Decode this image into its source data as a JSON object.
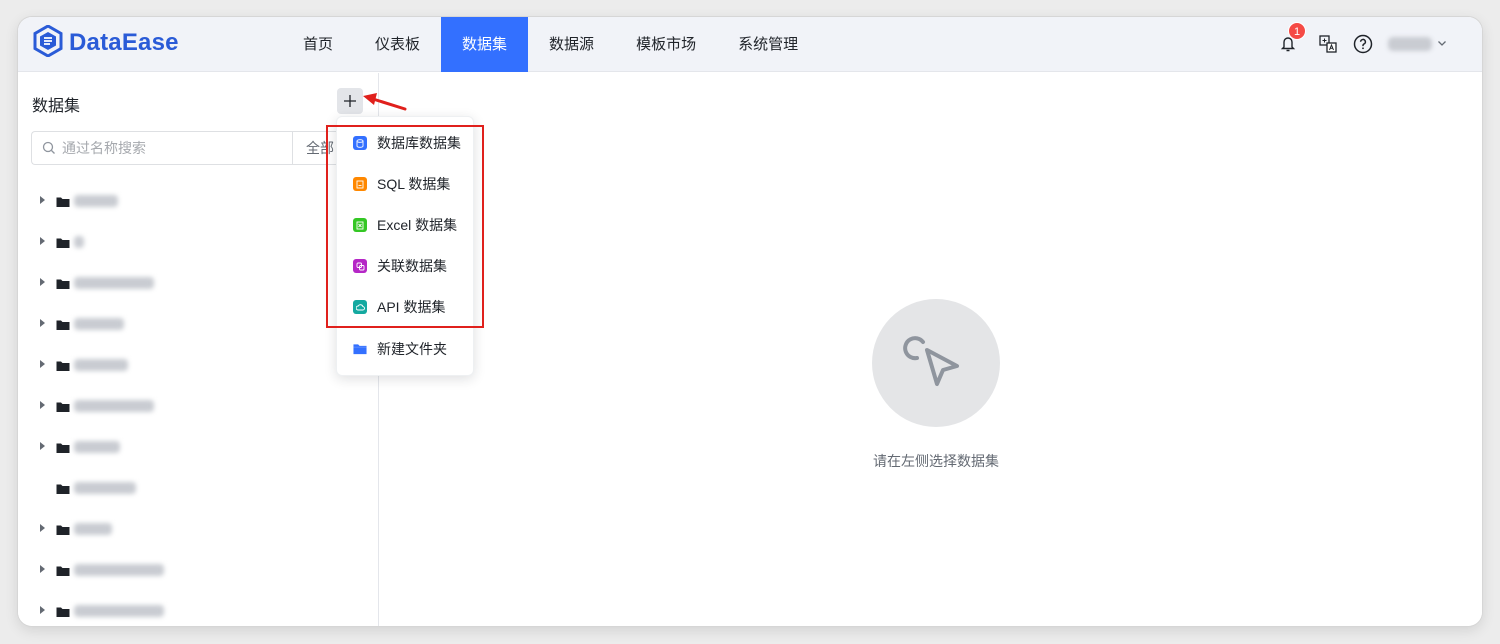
{
  "app": {
    "logo_text": "DataEase"
  },
  "nav": {
    "items": [
      {
        "label": "首页",
        "active": false
      },
      {
        "label": "仪表板",
        "active": false
      },
      {
        "label": "数据集",
        "active": true
      },
      {
        "label": "数据源",
        "active": false
      },
      {
        "label": "模板市场",
        "active": false
      },
      {
        "label": "系统管理",
        "active": false
      }
    ]
  },
  "toolbar": {
    "notification_count": "1"
  },
  "sidebar": {
    "title": "数据集",
    "search_placeholder": "通过名称搜索",
    "filter_label": "全部",
    "tree": [
      {
        "has_caret": true
      },
      {
        "has_caret": true
      },
      {
        "has_caret": true
      },
      {
        "has_caret": true
      },
      {
        "has_caret": true
      },
      {
        "has_caret": true
      },
      {
        "has_caret": true
      },
      {
        "has_caret": false
      },
      {
        "has_caret": true
      },
      {
        "has_caret": true
      },
      {
        "has_caret": true
      }
    ]
  },
  "menu": {
    "items": [
      {
        "label": "数据库数据集",
        "icon": "database-icon",
        "color": "#3370ff"
      },
      {
        "label": "SQL 数据集",
        "icon": "sql-icon",
        "color": "#ff8800"
      },
      {
        "label": "Excel 数据集",
        "icon": "excel-icon",
        "color": "#34c724"
      },
      {
        "label": "关联数据集",
        "icon": "link-icon",
        "color": "#b527c6"
      },
      {
        "label": "API 数据集",
        "icon": "api-icon",
        "color": "#14a9a0"
      },
      {
        "label": "新建文件夹",
        "icon": "folder-icon",
        "color": "#3370ff"
      }
    ]
  },
  "main": {
    "empty_text": "请在左侧选择数据集"
  },
  "colors": {
    "accent": "#3370ff",
    "highlight": "#e0201c"
  }
}
